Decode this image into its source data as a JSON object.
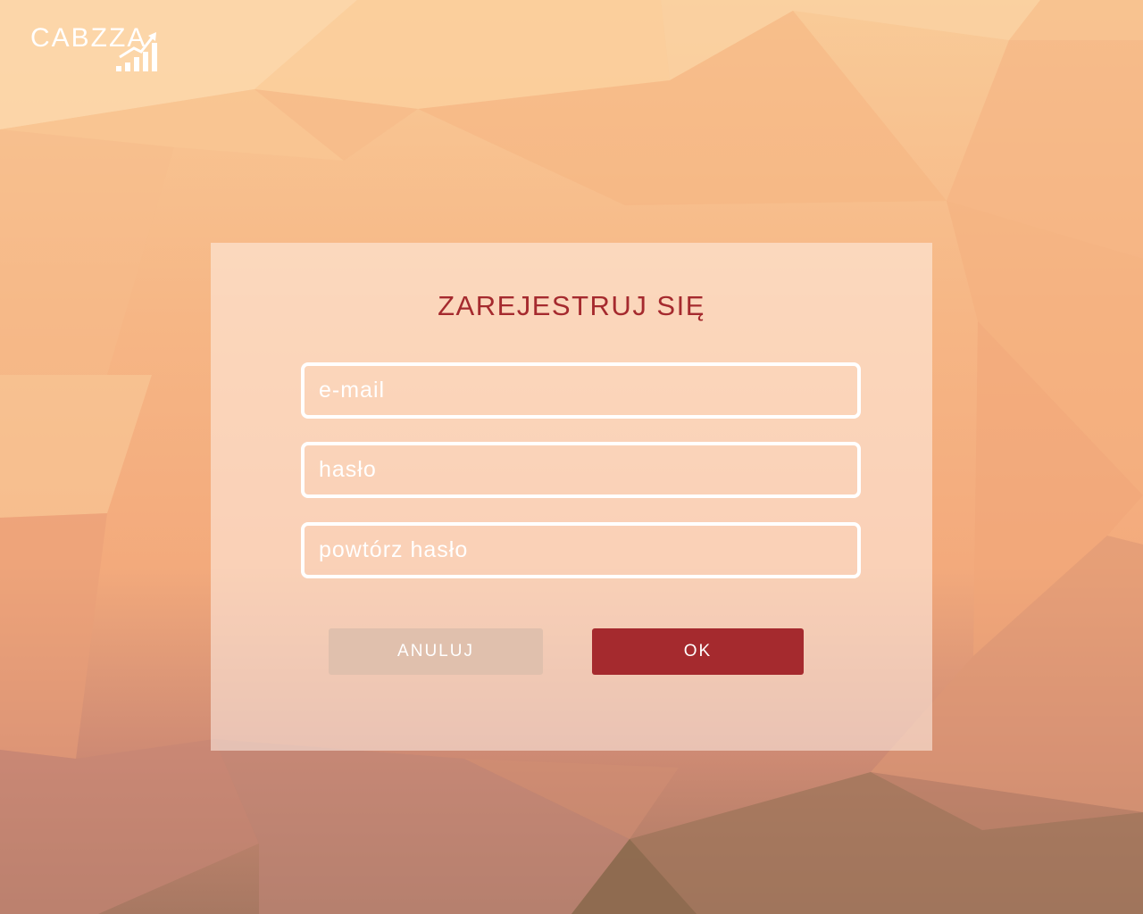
{
  "app": {
    "logo_text": "CABZZA"
  },
  "form": {
    "title": "ZAREJESTRUJ SIĘ",
    "email_placeholder": "e-mail",
    "password_placeholder": "hasło",
    "repeat_password_placeholder": "powtórz hasło",
    "cancel_label": "ANULUJ",
    "ok_label": "OK"
  },
  "colors": {
    "accent": "#a52a2e",
    "cancel_button": "#e0c0ad",
    "field_border": "#ffffff"
  },
  "icons": {
    "logo": "chart-growth-icon"
  }
}
